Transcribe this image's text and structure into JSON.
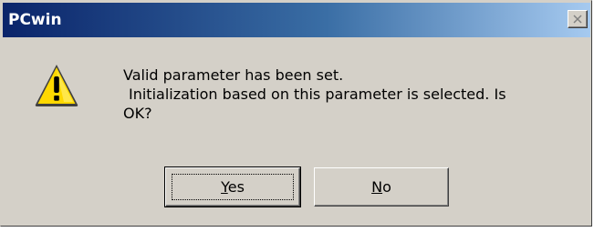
{
  "window": {
    "title": "PCwin"
  },
  "dialog": {
    "icon": "warning-icon",
    "message_lines": [
      "Valid parameter has been set.",
      "Initialization based on this parameter is selected. Is",
      "OK?"
    ],
    "buttons": [
      {
        "label": "Yes",
        "mnemonic": "Y",
        "rest": "es",
        "default": true
      },
      {
        "label": "No",
        "mnemonic": "N",
        "rest": "o",
        "default": false
      }
    ]
  },
  "colors": {
    "title_start": "#0a246a",
    "title_end": "#a6caf0",
    "face": "#d4d0c8",
    "warning_yellow": "#ffd800"
  }
}
